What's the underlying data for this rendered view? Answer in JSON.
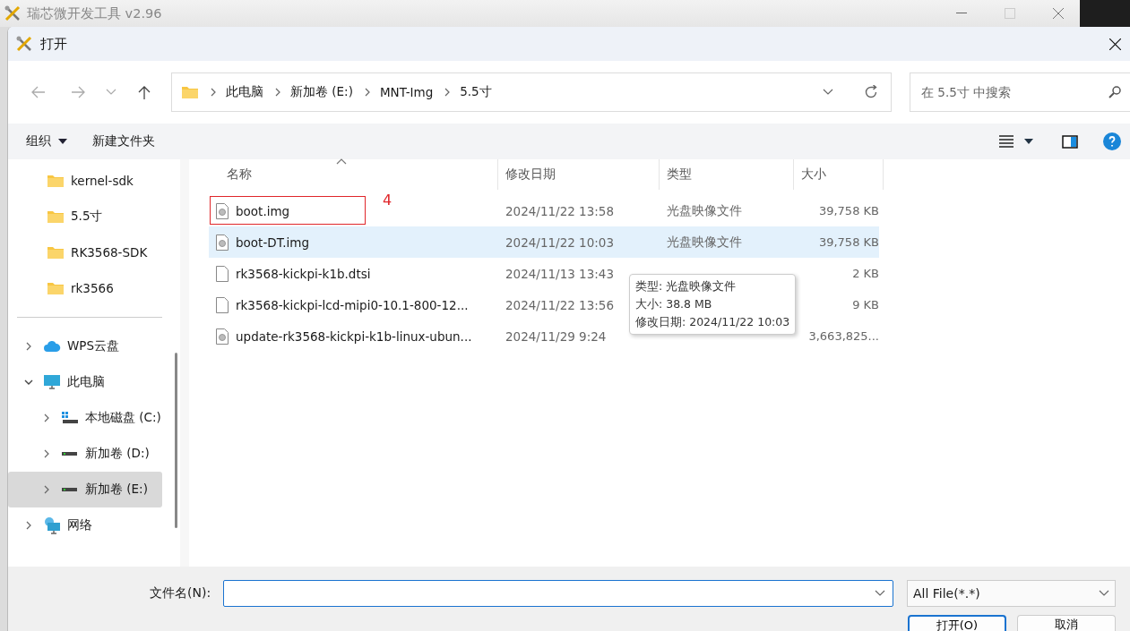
{
  "app_window": {
    "title": "瑞芯微开发工具 v2.96"
  },
  "dialog": {
    "title": "打开"
  },
  "breadcrumb": [
    "此电脑",
    "新加卷 (E:)",
    "MNT-Img",
    "5.5寸"
  ],
  "search": {
    "placeholder": "在 5.5寸 中搜索"
  },
  "toolbar": {
    "organize": "组织",
    "new_folder": "新建文件夹"
  },
  "sidebar": {
    "items": [
      {
        "label": "kernel-sdk",
        "kind": "folder",
        "selected": false
      },
      {
        "label": "5.5寸",
        "kind": "folder",
        "selected": false
      },
      {
        "label": "RK3568-SDK",
        "kind": "folder",
        "selected": false
      },
      {
        "label": "rk3566",
        "kind": "folder",
        "selected": false
      },
      {
        "label": "WPS云盘",
        "kind": "cloud",
        "selected": false,
        "expanded": false
      },
      {
        "label": "此电脑",
        "kind": "computer",
        "selected": false,
        "expanded": true,
        "children": [
          {
            "label": "本地磁盘 (C:)",
            "kind": "system-drive",
            "selected": false,
            "expanded": false
          },
          {
            "label": "新加卷 (D:)",
            "kind": "drive",
            "selected": false,
            "expanded": false
          },
          {
            "label": "新加卷 (E:)",
            "kind": "drive",
            "selected": true,
            "expanded": false
          }
        ]
      },
      {
        "label": "网络",
        "kind": "network",
        "selected": false,
        "expanded": false
      }
    ]
  },
  "table": {
    "columns": [
      "名称",
      "修改日期",
      "类型",
      "大小"
    ],
    "rows": [
      {
        "name": "boot.img",
        "kind": "disc-image",
        "date": "2024/11/22 13:58",
        "type": "光盘映像文件",
        "size": "39,758 KB",
        "selected": false,
        "annotation": "4"
      },
      {
        "name": "boot-DT.img",
        "kind": "disc-image",
        "date": "2024/11/22 10:03",
        "type": "光盘映像文件",
        "size": "39,758 KB",
        "selected": true
      },
      {
        "name": "rk3568-kickpi-k1b.dtsi",
        "kind": "document",
        "date": "2024/11/13 13:43",
        "size": "2 KB",
        "selected": false
      },
      {
        "name": "rk3568-kickpi-lcd-mipi0-10.1-800-12...",
        "kind": "document",
        "date": "2024/11/22 13:56",
        "size": "9 KB",
        "selected": false
      },
      {
        "name": "update-rk3568-kickpi-k1b-linux-ubun...",
        "kind": "disc-image",
        "date": "2024/11/29 9:24",
        "size": "3,663,825...",
        "selected": false
      }
    ]
  },
  "tooltip": {
    "lines": [
      "类型: 光盘映像文件",
      "大小: 38.8 MB",
      "修改日期: 2024/11/22 10:03"
    ]
  },
  "footer": {
    "file_name_label": "文件名(N):",
    "file_type": "All File(*.*)",
    "open_button": "打开(O)",
    "cancel_button": "取消"
  }
}
